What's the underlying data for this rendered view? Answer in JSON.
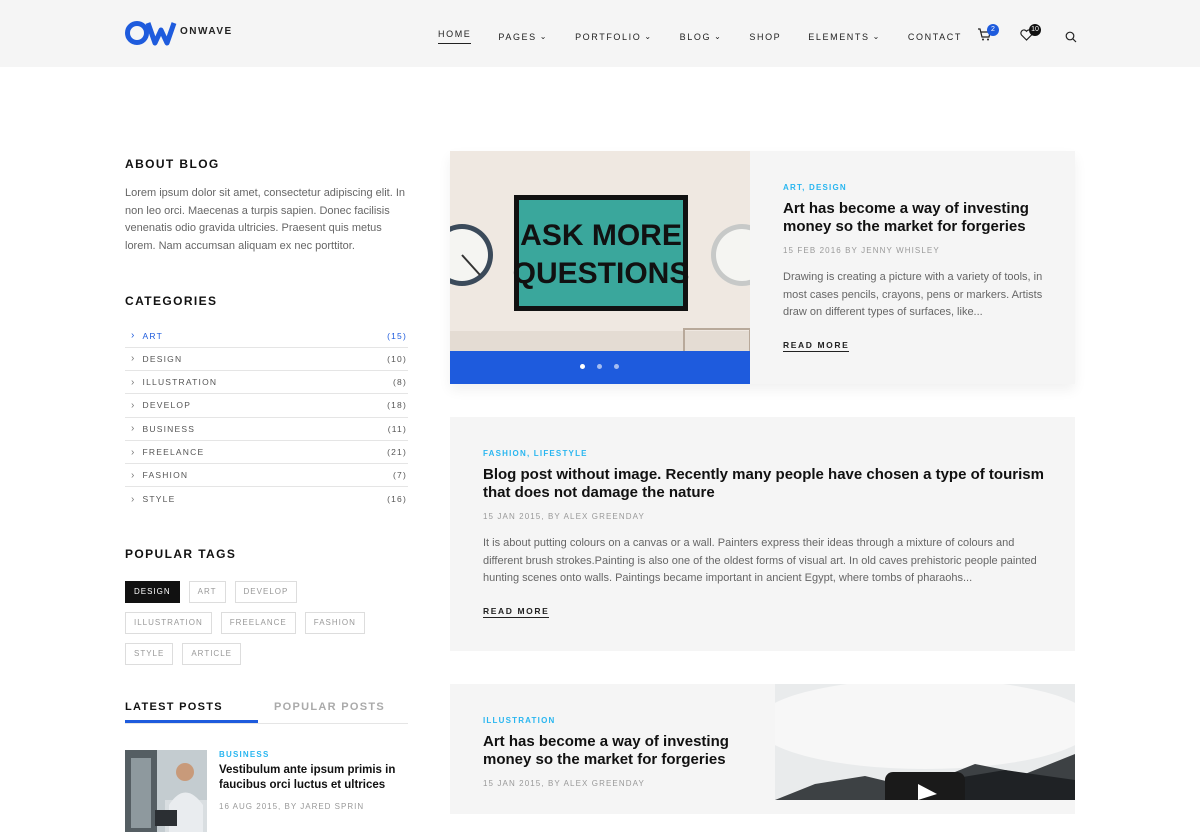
{
  "brand": {
    "name": "ONWAVE",
    "accent": "#1e5bdd",
    "tag_color": "#29b6f0"
  },
  "nav": [
    {
      "label": "HOME",
      "dropdown": false,
      "active": true
    },
    {
      "label": "PAGES",
      "dropdown": true
    },
    {
      "label": "PORTFOLIO",
      "dropdown": true
    },
    {
      "label": "BLOG",
      "dropdown": true
    },
    {
      "label": "SHOP",
      "dropdown": false
    },
    {
      "label": "ELEMENTS",
      "dropdown": true
    },
    {
      "label": "CONTACT",
      "dropdown": false
    }
  ],
  "header_icons": {
    "cart_count": "2",
    "wishlist_count": "10"
  },
  "about": {
    "title": "ABOUT BLOG",
    "text": "Lorem ipsum dolor sit amet, consectetur adipiscing elit. In non leo orci. Maecenas a turpis sapien. Donec facilisis venenatis odio gravida ultricies. Praesent quis metus lorem. Nam accumsan aliquam ex nec porttitor."
  },
  "categories": {
    "title": "CATEGORIES",
    "items": [
      {
        "name": "ART",
        "count": "(15)",
        "active": true
      },
      {
        "name": "DESIGN",
        "count": "(10)"
      },
      {
        "name": "ILLUSTRATION",
        "count": "(8)"
      },
      {
        "name": "DEVELOP",
        "count": "(18)"
      },
      {
        "name": "BUSINESS",
        "count": "(11)"
      },
      {
        "name": "FREELANCE",
        "count": "(21)"
      },
      {
        "name": "FASHION",
        "count": "(7)"
      },
      {
        "name": "STYLE",
        "count": "(16)"
      }
    ]
  },
  "tags": {
    "title": "POPULAR TAGS",
    "items": [
      {
        "label": "DESIGN",
        "active": true
      },
      {
        "label": "ART"
      },
      {
        "label": "DEVELOP"
      },
      {
        "label": "ILLUSTRATION"
      },
      {
        "label": "FREELANCE"
      },
      {
        "label": "FASHION"
      },
      {
        "label": "STYLE"
      },
      {
        "label": "ARTICLE"
      }
    ]
  },
  "posts_tabs": {
    "latest": "LATEST POSTS",
    "popular": "POPULAR POSTS"
  },
  "latest_post": {
    "category": "BUSINESS",
    "title": "Vestibulum ante ipsum primis in faucibus orci luctus et ultrices",
    "date": "16 AUG 2015, BY JARED SPRIN"
  },
  "posts": [
    {
      "category": "ART, DESIGN",
      "title": "Art has become a way of investing money so the market for forgeries",
      "date": "15 FEB 2016 BY JENNY WHISLEY",
      "excerpt": "Drawing is creating a picture with a variety of tools, in most cases pencils, crayons, pens or markers. Artists draw on different types of surfaces, like...",
      "read_more": "READ MORE",
      "image_text": [
        "ASK MORE",
        "QUESTIONS"
      ]
    },
    {
      "category": "FASHION, LIFESTYLE",
      "title": "Blog post without image. Recently many people have chosen a type of tourism that does not damage the nature",
      "date": "15 JAN 2015, BY ALEX GREENDAY",
      "excerpt": "It is about putting colours on a canvas or a wall. Painters express their ideas through a mixture of colours and different brush strokes.Painting is also one of the oldest forms of visual art. In old caves prehistoric people painted hunting scenes onto walls. Paintings became important in ancient Egypt, where tombs of pharaohs...",
      "read_more": "READ MORE"
    },
    {
      "category": "ILLUSTRATION",
      "title": "Art has become a way of investing money so the market for forgeries",
      "date": "15 JAN 2015, BY ALEX GREENDAY"
    }
  ]
}
